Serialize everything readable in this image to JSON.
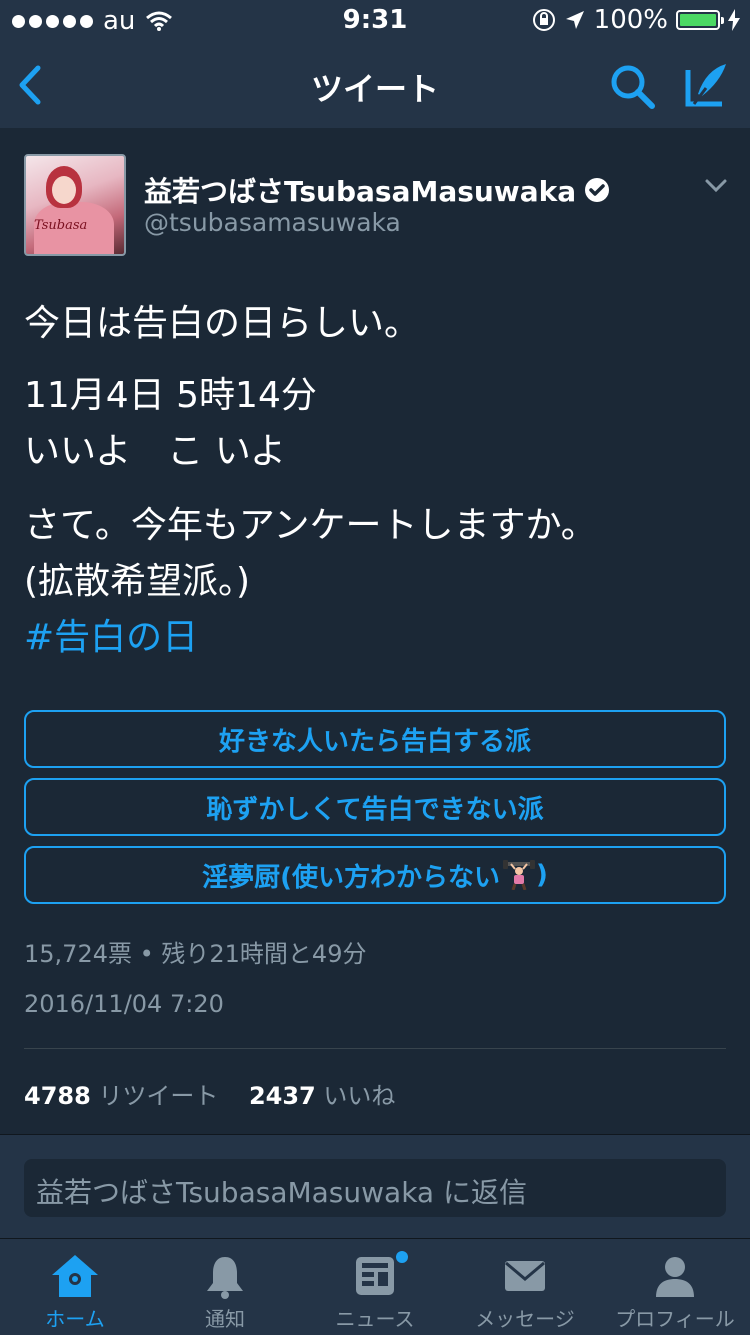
{
  "status_bar": {
    "carrier": "au",
    "time": "9:31",
    "battery": "100%"
  },
  "nav": {
    "title": "ツイート",
    "icons": [
      "back-chevron-icon",
      "search-icon",
      "compose-icon"
    ]
  },
  "tweet": {
    "author_name": "益若つばさTsubasaMasuwaka",
    "author_handle": "@tsubasamasuwaka",
    "avatar_text": "Tsubasa",
    "lines": [
      "今日は告白の日らしい。",
      "11月4日 5時14分",
      "いいよ　こ いよ",
      "さて。今年もアンケートしますか。",
      "(拡散希望派。)"
    ],
    "hashtag": "#告白の日",
    "poll": {
      "options": [
        "好きな人いたら告白する派",
        "恥ずかしくて告白できない派",
        "淫夢厨(使い方わからない",
        ")"
      ],
      "meta": "15,724票 • 残り21時間と49分"
    },
    "timestamp": "2016/11/04 7:20",
    "retweet_count": "4788",
    "retweet_label": "リツイート",
    "like_count": "2437",
    "like_label": "いいね"
  },
  "reply": {
    "placeholder": "益若つばさTsubasaMasuwaka に返信"
  },
  "tabs": [
    {
      "label": "ホーム",
      "icon": "home-icon",
      "active": true
    },
    {
      "label": "通知",
      "icon": "bell-icon",
      "active": false
    },
    {
      "label": "ニュース",
      "icon": "news-icon",
      "active": false
    },
    {
      "label": "メッセージ",
      "icon": "envelope-icon",
      "active": false
    },
    {
      "label": "プロフィール",
      "icon": "person-icon",
      "active": false
    }
  ],
  "colors": {
    "background": "#1b2836",
    "bar": "#243447",
    "accent": "#1da1f2",
    "muted": "#8899a6",
    "battery": "#4cd964"
  }
}
